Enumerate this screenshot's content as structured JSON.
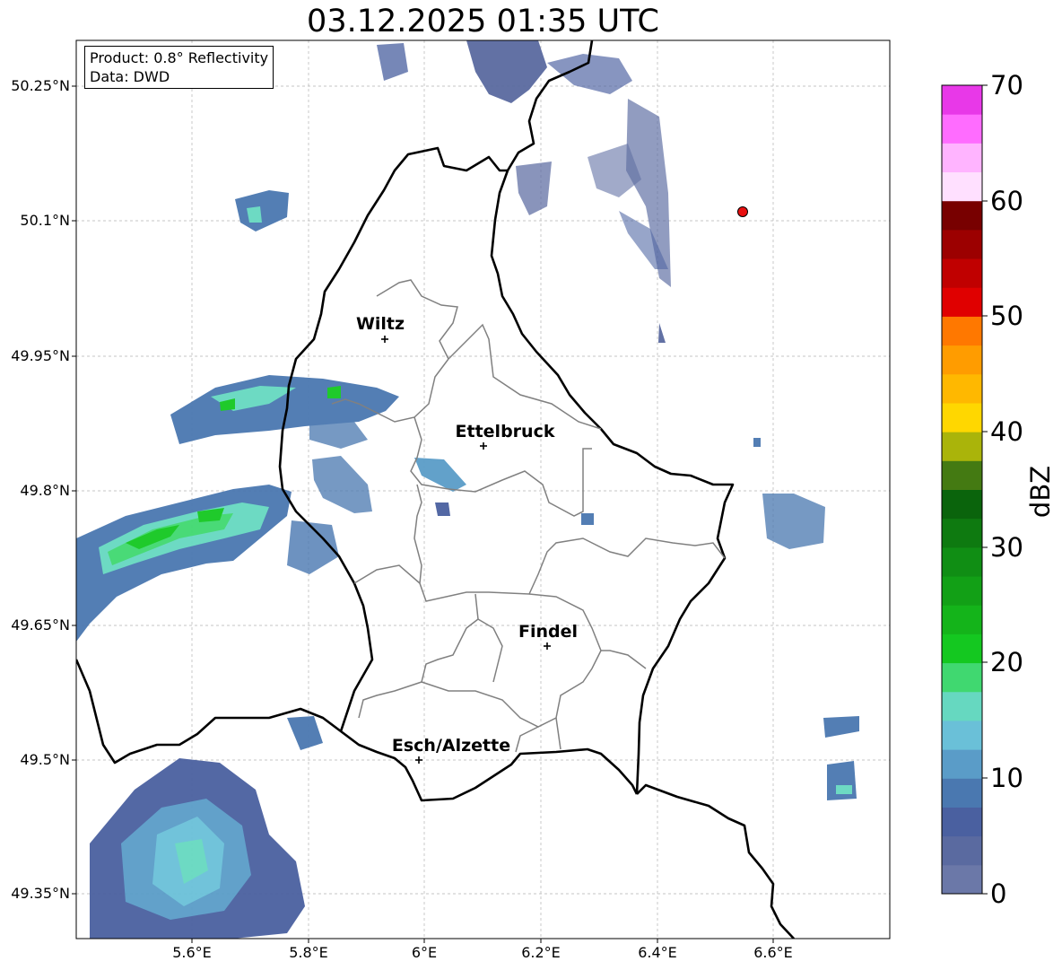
{
  "title": "03.12.2025 01:35 UTC",
  "info": {
    "product": "Product: 0.8° Reflectivity",
    "source": "Data: DWD"
  },
  "lat_labels": [
    "50.25°N",
    "50.1°N",
    "49.95°N",
    "49.8°N",
    "49.65°N",
    "49.5°N",
    "49.35°N"
  ],
  "lon_labels": [
    "5.6°E",
    "5.8°E",
    "6°E",
    "6.2°E",
    "6.4°E",
    "6.6°E"
  ],
  "cities": [
    {
      "name": "Wiltz",
      "lon": 5.93,
      "lat": 49.97
    },
    {
      "name": "Ettelbruck",
      "lon": 6.1,
      "lat": 49.85
    },
    {
      "name": "Findel",
      "lon": 6.21,
      "lat": 49.63
    },
    {
      "name": "Esch/Alzette",
      "lon": 5.99,
      "lat": 49.5
    }
  ],
  "marker": {
    "lon": 6.545,
    "lat": 50.11,
    "color": "#e81010"
  },
  "colorbar": {
    "label": "dBZ",
    "tick_labels": [
      "0",
      "10",
      "20",
      "30",
      "40",
      "50",
      "60",
      "70"
    ],
    "min": 0,
    "max": 70,
    "colors": [
      "#6b78a8",
      "#5a6aa0",
      "#4a60a0",
      "#4a78b0",
      "#5a9cc8",
      "#6ac0d8",
      "#66d8c0",
      "#40d870",
      "#14c820",
      "#14b41a",
      "#12a016",
      "#108e14",
      "#0e7a10",
      "#0a640c",
      "#447a12",
      "#aab40a",
      "#ffd700",
      "#ffb800",
      "#ff9c00",
      "#ff7800",
      "#e00000",
      "#c00000",
      "#9c0000",
      "#780000",
      "#ffe0ff",
      "#ffb4ff",
      "#ff6cff",
      "#e838e8"
    ]
  },
  "colors": {
    "border": "#000000",
    "canton": "#808080",
    "grid": "#b4b4b4"
  }
}
